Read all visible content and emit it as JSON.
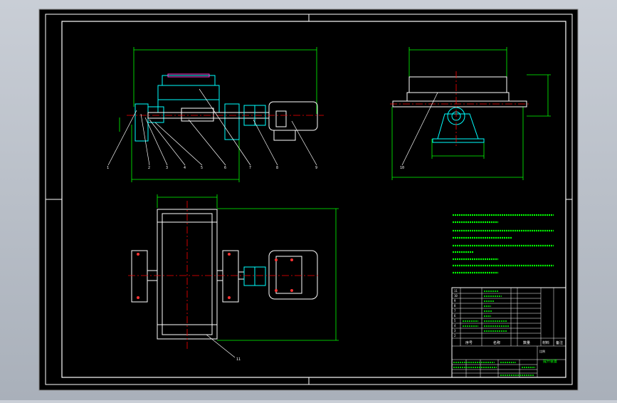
{
  "colors": {
    "canvas": "#000000",
    "frame": "#ffffff",
    "dimension": "#00ff00",
    "centerline": "#ff0000",
    "leader": "#ffffff",
    "cyan": "#00ffff",
    "magenta": "#ff33cc",
    "yellow": "#ffff00",
    "note_text": "#00ff00"
  },
  "front_view": {
    "balloons": [
      "1",
      "2",
      "3",
      "4",
      "5",
      "6",
      "7",
      "8",
      "9"
    ]
  },
  "side_view": {
    "balloons": [
      "10"
    ]
  },
  "plan_view": {
    "balloons": [
      "11"
    ]
  },
  "title_block": {
    "header": [
      "序号",
      "名称",
      "数量",
      "材料",
      "备注"
    ],
    "drawing_title": "提升装置",
    "scale_label": "比例",
    "rows": [
      "11",
      "10",
      "9",
      "8",
      "7",
      "6",
      "5",
      "4",
      "3",
      "2",
      "1"
    ]
  }
}
